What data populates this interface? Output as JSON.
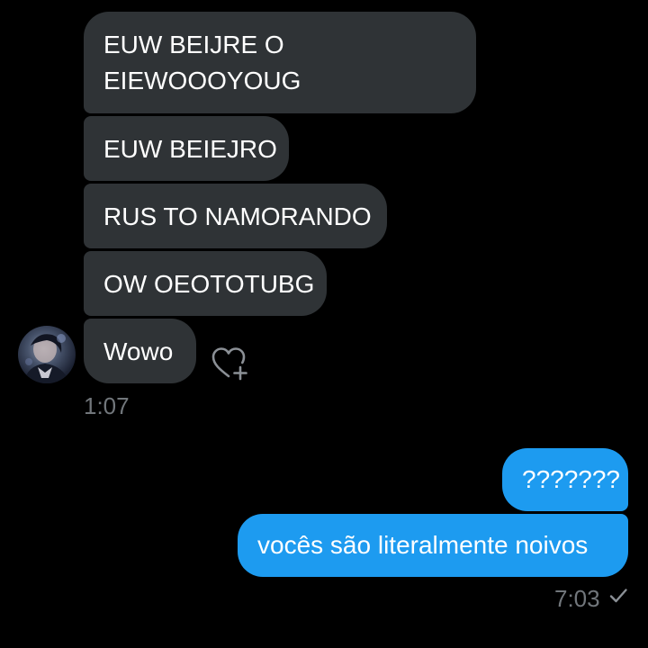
{
  "conversation": {
    "received": [
      {
        "line1": "EUW BEIJRE O",
        "line2": "EIEWOOOYOUG"
      },
      {
        "text": "EUW BEIEJRO"
      },
      {
        "text": "RUS TO NAMORANDO"
      },
      {
        "text": "OW OEOTOTUBG"
      },
      {
        "text": "Wowo"
      }
    ],
    "received_time": "1:07",
    "sent": [
      {
        "text": "???????"
      },
      {
        "text": "vocês são literalmente noivos"
      }
    ],
    "sent_time": "7:03"
  },
  "icons": {
    "avatar": "contact-avatar",
    "react": "heart-plus-icon",
    "status": "checkmark-icon"
  },
  "colors": {
    "background": "#000000",
    "received_bubble": "#2f3336",
    "sent_bubble": "#1d9bf0",
    "timestamp": "#71767b"
  }
}
